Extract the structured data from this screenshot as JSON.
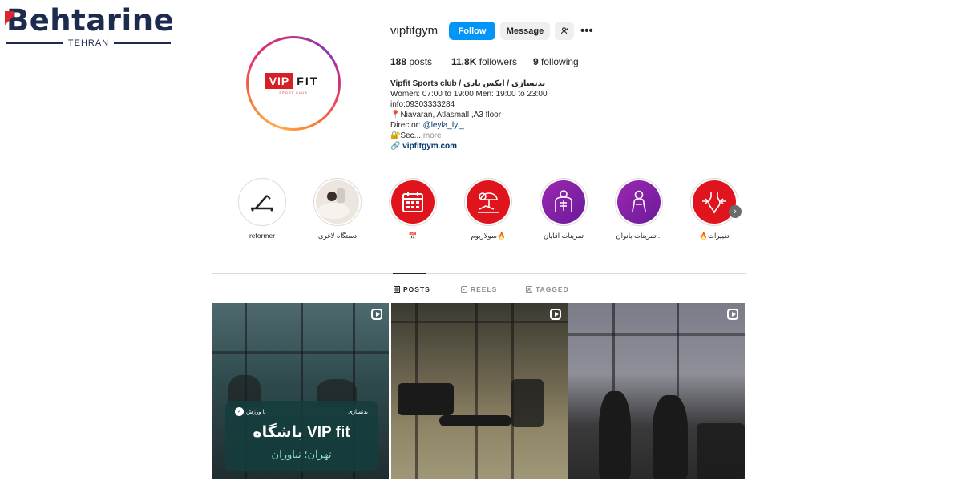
{
  "watermark": {
    "word": "ehtarine",
    "first_letter": "B",
    "city": "TEHRAN"
  },
  "profile": {
    "username": "vipfitgym",
    "avatar_logo": {
      "vip": "VIP",
      "fit": "FIT",
      "sub": "SPORT CLUB"
    },
    "actions": {
      "follow": "Follow",
      "message": "Message",
      "more": "•••"
    },
    "stats": {
      "posts_count": "188",
      "posts_label": "posts",
      "followers_count": "11.8K",
      "followers_label": "followers",
      "following_count": "9",
      "following_label": "following"
    },
    "bio": {
      "name": "Vipfit Sports club / بدنسازی / ایکس بادی",
      "line1": "Women: 07:00 to 19:00 Men: 19:00 to 23:00",
      "line2": "info:09303333284",
      "line3": "📍Niavaran, Atlasmall ,A3 floor",
      "director_prefix": "Director: ",
      "director_handle": "@leyla_ly._",
      "line5": "🔐Sec...",
      "more": "more",
      "website": "vipfitgym.com"
    }
  },
  "highlights": [
    {
      "label": "reformer",
      "bg": "#ffffff",
      "icon": "reformer-icon"
    },
    {
      "label": "دستگاه لاغری",
      "bg": "#e9e2dc",
      "icon": "slimming-device-icon"
    },
    {
      "label": "📅",
      "bg": "#e0141c",
      "icon": "calendar-icon"
    },
    {
      "label": "سولاریوم🔥",
      "bg": "#e0141c",
      "icon": "solarium-icon"
    },
    {
      "label": "تمرینات آقایان",
      "bg": "#7b1fa2",
      "icon": "men-workout-icon"
    },
    {
      "label": "تمرینات بانوان...",
      "bg": "#7b1fa2",
      "icon": "women-workout-icon"
    },
    {
      "label": "🔥تغییرات",
      "bg": "#e0141c",
      "icon": "body-change-icon"
    }
  ],
  "tabs": [
    {
      "label": "POSTS",
      "icon": "grid-icon",
      "active": true
    },
    {
      "label": "REELS",
      "icon": "reels-icon",
      "active": false
    },
    {
      "label": "TAGGED",
      "icon": "tagged-icon",
      "active": false
    }
  ],
  "posts": {
    "p1": {
      "tag": "بدنسازی",
      "logo": "با ورزش",
      "title": "باشگاه VIP fit",
      "subtitle": "تهران؛ نیاوران"
    }
  },
  "colors": {
    "follow_blue": "#0095f6",
    "brand_red": "#d71f26",
    "link": "#00376b"
  }
}
